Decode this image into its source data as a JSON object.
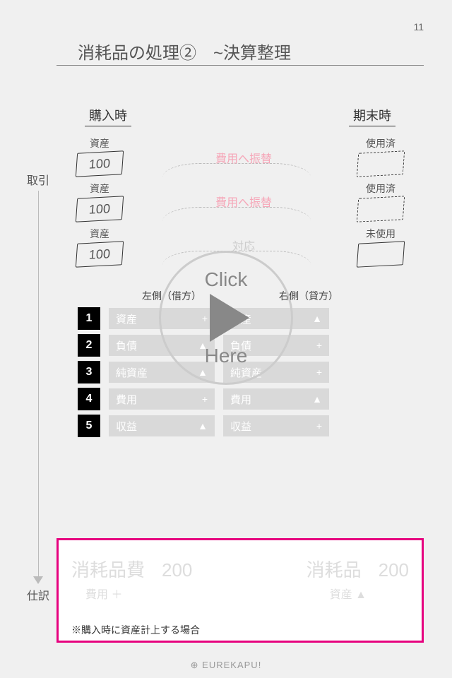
{
  "page_number": "11",
  "title": "消耗品の処理②　~決算整理",
  "side_labels": {
    "torihiki": "取引",
    "shiwake": "仕訳"
  },
  "columns": {
    "left": "購入時",
    "right": "期末時"
  },
  "assets": {
    "left_rows": [
      {
        "label": "資産",
        "value": "100"
      },
      {
        "label": "資産",
        "value": "100"
      },
      {
        "label": "資産",
        "value": "100"
      }
    ],
    "right_rows": [
      {
        "label": "使用済"
      },
      {
        "label": "使用済"
      },
      {
        "label": "未使用"
      }
    ],
    "transfers": [
      "費用へ振替",
      "費用へ振替",
      "対応"
    ]
  },
  "table": {
    "head_left": "左側（借方）",
    "head_right": "右側（貸方）",
    "rows": [
      {
        "n": "1",
        "l": "資産",
        "lsym": "+",
        "r": "資産",
        "rsym": "▲"
      },
      {
        "n": "2",
        "l": "負債",
        "lsym": "▲",
        "r": "負債",
        "rsym": "+"
      },
      {
        "n": "3",
        "l": "純資産",
        "lsym": "▲",
        "r": "純資産",
        "rsym": "+"
      },
      {
        "n": "4",
        "l": "費用",
        "lsym": "+",
        "r": "費用",
        "rsym": "▲"
      },
      {
        "n": "5",
        "l": "収益",
        "lsym": "▲",
        "r": "収益",
        "rsym": "+"
      }
    ]
  },
  "journal": {
    "debit_account": "消耗品費",
    "debit_amount": "200",
    "credit_account": "消耗品",
    "credit_amount": "200",
    "debit_sub": "費用 ＋",
    "credit_sub": "資産 ▲",
    "note": "※購入時に資産計上する場合"
  },
  "play": {
    "top": "Click",
    "bottom": "Here"
  },
  "footer_brand": "⊕ EUREKAPU!"
}
